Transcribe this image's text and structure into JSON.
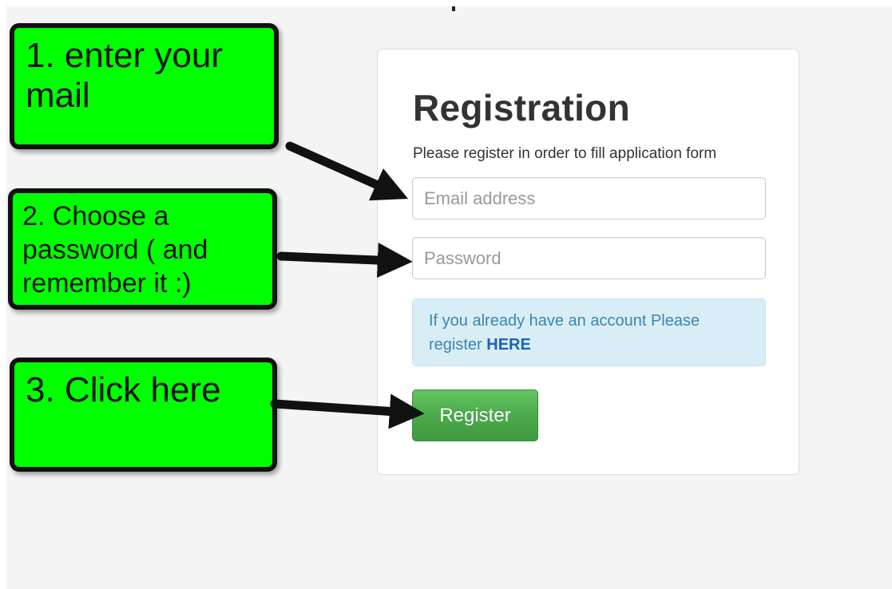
{
  "form": {
    "title": "Registration",
    "subtitle": "Please register in order to fill application form",
    "email_placeholder": "Email address",
    "password_placeholder": "Password",
    "info_text": "If you already have an account Please register ",
    "info_link": "HERE",
    "register_label": "Register"
  },
  "callouts": {
    "step1": "1. enter your mail",
    "step2": "2. Choose a password ( and remember it :)",
    "step3": "3. Click here"
  },
  "colors": {
    "callout_bg": "#00ff00",
    "button_green": "#4aa84a",
    "info_bg": "#d9edf7",
    "info_text": "#3a87ad",
    "link": "#1a64b3",
    "page_bg": "#f4f4f4"
  }
}
